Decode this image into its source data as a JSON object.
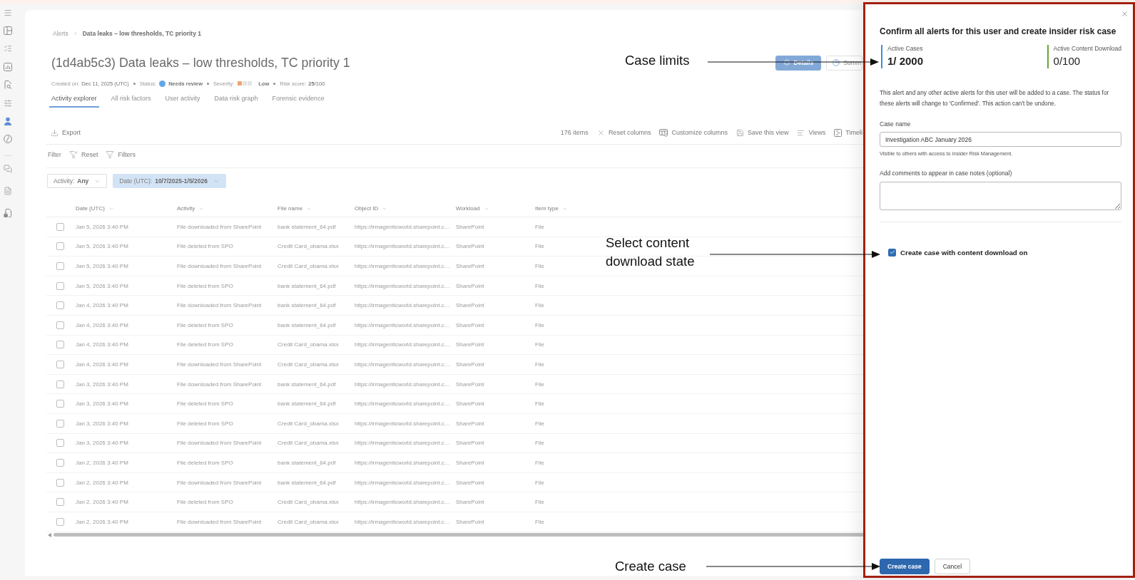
{
  "nav_rail": [
    {
      "selected": false
    },
    {
      "selected": false
    },
    {
      "selected": false
    },
    {
      "selected": false
    },
    {
      "selected": false
    },
    {
      "selected": false
    },
    {
      "selected": true
    },
    {
      "selected": false
    },
    {
      "selected": false
    },
    {
      "selected": false
    },
    {
      "selected": false
    }
  ],
  "breadcrumb": [
    {
      "label": "Alerts",
      "current": false
    },
    {
      "label": "Data leaks – low thresholds, TC priority 1",
      "current": true
    }
  ],
  "title": "(1d4ab5c3) Data leaks – low thresholds, TC priority 1",
  "view_toggle": [
    {
      "kind": "details",
      "label": "Details",
      "selected": true
    },
    {
      "kind": "summary",
      "label": "Summ",
      "selected": false
    }
  ],
  "meta": [
    {
      "kind": "text",
      "label": "Created on:",
      "value": "Dec 11, 2025 (UTC)"
    },
    {
      "kind": "status",
      "label": "Status:",
      "value": "Needs review"
    },
    {
      "kind": "severity",
      "label": "Severity:",
      "value": "Low",
      "level": 0.33
    },
    {
      "kind": "score",
      "label": "Risk score:",
      "value": "**25**/100"
    }
  ],
  "tabs": [
    {
      "label": "Activity explorer",
      "selected": true
    },
    {
      "label": "All risk factors",
      "selected": false
    },
    {
      "label": "User activity",
      "selected": false
    },
    {
      "label": "Data risk graph",
      "selected": false
    },
    {
      "label": "Forensic evidence",
      "selected": false
    }
  ],
  "toolbar": {
    "export": "Export",
    "count": "176 items",
    "actions": [
      {
        "kind": "reset",
        "label": "Reset columns"
      },
      {
        "kind": "columns",
        "label": "Customize columns"
      },
      {
        "kind": "save",
        "label": "Save this view"
      },
      {
        "kind": "views",
        "label": "Views"
      },
      {
        "kind": "timeline",
        "label": "Timeli"
      }
    ]
  },
  "filter_bar": {
    "label": "Filter",
    "actions": [
      {
        "kind": "reset",
        "label": "Reset"
      },
      {
        "kind": "filters",
        "label": "Filters"
      }
    ]
  },
  "filter_chips": [
    {
      "label": "Activity:",
      "value": "Any",
      "selected": false
    },
    {
      "label": "Date (UTC):",
      "value": "10/7/2025-1/5/2026",
      "selected": true
    }
  ],
  "table": {
    "columns": [
      "Date (UTC)",
      "Activity",
      "File name",
      "Object ID",
      "Workload",
      "Item type"
    ],
    "rows": [
      {
        "checked": false,
        "cells": [
          "Jan 5, 2026 3:40 PM",
          "File downloaded from SharePoint",
          "bank statement_64.pdf",
          "https://irmagenticworld.sharepoint.c…",
          "SharePoint",
          "File"
        ]
      },
      {
        "checked": false,
        "cells": [
          "Jan 5, 2026 3:40 PM",
          "File deleted from SPO",
          "Credit Card_obama.xlsx",
          "https://irmagenticworld.sharepoint.c…",
          "SharePoint",
          "File"
        ]
      },
      {
        "checked": false,
        "cells": [
          "Jan 5, 2026 3:40 PM",
          "File downloaded from SharePoint",
          "Credit Card_obama.xlsx",
          "https://irmagenticworld.sharepoint.c…",
          "SharePoint",
          "File"
        ]
      },
      {
        "checked": false,
        "cells": [
          "Jan 5, 2026 3:40 PM",
          "File deleted from SPO",
          "bank statement_64.pdf",
          "https://irmagenticworld.sharepoint.c…",
          "SharePoint",
          "File"
        ]
      },
      {
        "checked": false,
        "cells": [
          "Jan 4, 2026 3:40 PM",
          "File downloaded from SharePoint",
          "bank statement_64.pdf",
          "https://irmagenticworld.sharepoint.c…",
          "SharePoint",
          "File"
        ]
      },
      {
        "checked": false,
        "cells": [
          "Jan 4, 2026 3:40 PM",
          "File deleted from SPO",
          "bank statement_64.pdf",
          "https://irmagenticworld.sharepoint.c…",
          "SharePoint",
          "File"
        ]
      },
      {
        "checked": false,
        "cells": [
          "Jan 4, 2026 3:40 PM",
          "File deleted from SPO",
          "Credit Card_obama.xlsx",
          "https://irmagenticworld.sharepoint.c…",
          "SharePoint",
          "File"
        ]
      },
      {
        "checked": false,
        "cells": [
          "Jan 4, 2026 3:40 PM",
          "File downloaded from SharePoint",
          "Credit Card_obama.xlsx",
          "https://irmagenticworld.sharepoint.c…",
          "SharePoint",
          "File"
        ]
      },
      {
        "checked": false,
        "cells": [
          "Jan 3, 2026 3:40 PM",
          "File downloaded from SharePoint",
          "bank statement_64.pdf",
          "https://irmagenticworld.sharepoint.c…",
          "SharePoint",
          "File"
        ]
      },
      {
        "checked": false,
        "cells": [
          "Jan 3, 2026 3:40 PM",
          "File deleted from SPO",
          "bank statement_64.pdf",
          "https://irmagenticworld.sharepoint.c…",
          "SharePoint",
          "File"
        ]
      },
      {
        "checked": false,
        "cells": [
          "Jan 3, 2026 3:40 PM",
          "File deleted from SPO",
          "Credit Card_obama.xlsx",
          "https://irmagenticworld.sharepoint.c…",
          "SharePoint",
          "File"
        ]
      },
      {
        "checked": false,
        "cells": [
          "Jan 3, 2026 3:40 PM",
          "File downloaded from SharePoint",
          "Credit Card_obama.xlsx",
          "https://irmagenticworld.sharepoint.c…",
          "SharePoint",
          "File"
        ]
      },
      {
        "checked": false,
        "cells": [
          "Jan 2, 2026 3:40 PM",
          "File deleted from SPO",
          "bank statement_64.pdf",
          "https://irmagenticworld.sharepoint.c…",
          "SharePoint",
          "File"
        ]
      },
      {
        "checked": false,
        "cells": [
          "Jan 2, 2026 3:40 PM",
          "File downloaded from SharePoint",
          "bank statement_64.pdf",
          "https://irmagenticworld.sharepoint.c…",
          "SharePoint",
          "File"
        ]
      },
      {
        "checked": false,
        "cells": [
          "Jan 2, 2026 3:40 PM",
          "File deleted from SPO",
          "Credit Card_obama.xlsx",
          "https://irmagenticworld.sharepoint.c…",
          "SharePoint",
          "File"
        ]
      },
      {
        "checked": false,
        "cells": [
          "Jan 2, 2026 3:40 PM",
          "File downloaded from SharePoint",
          "Credit Card_obama.xlsx",
          "https://irmagenticworld.sharepoint.c…",
          "SharePoint",
          "File"
        ]
      }
    ]
  },
  "panel": {
    "title": "Confirm all alerts for this user and create insider risk case",
    "stats": [
      {
        "label": "Active Cases",
        "value": "1/ 2000",
        "color": "#3a8ee0",
        "emphasized": true
      },
      {
        "label": "Active Content Download",
        "value": "0/100",
        "color": "#6aa232",
        "emphasized": false
      }
    ],
    "description": "This alert and any other active alerts for this user will be added to a case. The status for these alerts will change to 'Confirmed'. This action can't be undone.",
    "case_name": {
      "label": "Case name",
      "value": "Investigation ABC January 2026",
      "hint": "Visible to others with access to Insider Risk Management."
    },
    "comments": {
      "label": "Add comments to appear in case notes (optional)"
    },
    "content_download": {
      "label": "Create case with content download on",
      "checked": true
    },
    "buttons": [
      {
        "label": "Create case",
        "primary": true
      },
      {
        "label": "Cancel",
        "primary": false
      }
    ]
  },
  "annotations": [
    {
      "text": "Case limits"
    },
    {
      "text": "Select content download state"
    },
    {
      "text": "Create case"
    }
  ]
}
